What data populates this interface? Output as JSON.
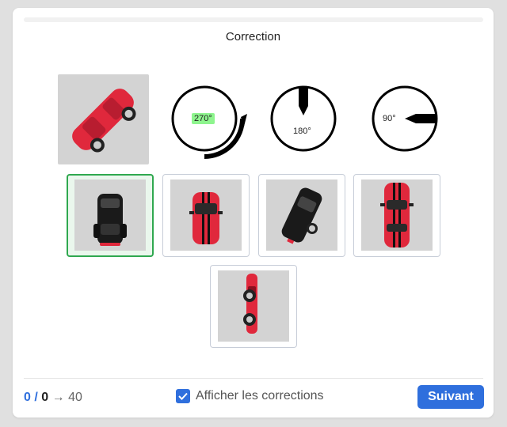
{
  "card": {
    "title": "Correction"
  },
  "dials": [
    {
      "label": "270°",
      "highlighted": true
    },
    {
      "label": "180°",
      "highlighted": false
    },
    {
      "label": "90°",
      "highlighted": false
    }
  ],
  "options": [
    {
      "name": "option-1",
      "selected": true,
      "car_view": "top-down black car"
    },
    {
      "name": "option-2",
      "selected": false,
      "car_view": "top-down red car"
    },
    {
      "name": "option-3",
      "selected": false,
      "car_view": "rotated black car"
    },
    {
      "name": "option-4",
      "selected": false,
      "car_view": "top-down red car with black stripes"
    },
    {
      "name": "option-5",
      "selected": false,
      "car_view": "red car side view rotated"
    }
  ],
  "footer": {
    "score_current": "0",
    "score_sep": " / ",
    "score_total": "0",
    "arrow": "→",
    "score_target": "40",
    "show_corrections_label": "Afficher les corrections",
    "show_corrections_checked": true,
    "next_label": "Suivant"
  },
  "colors": {
    "accent": "#2f6fdd",
    "selected_border": "#2fa84f",
    "badge": "#8ef58e",
    "car_red": "#e0283c"
  }
}
